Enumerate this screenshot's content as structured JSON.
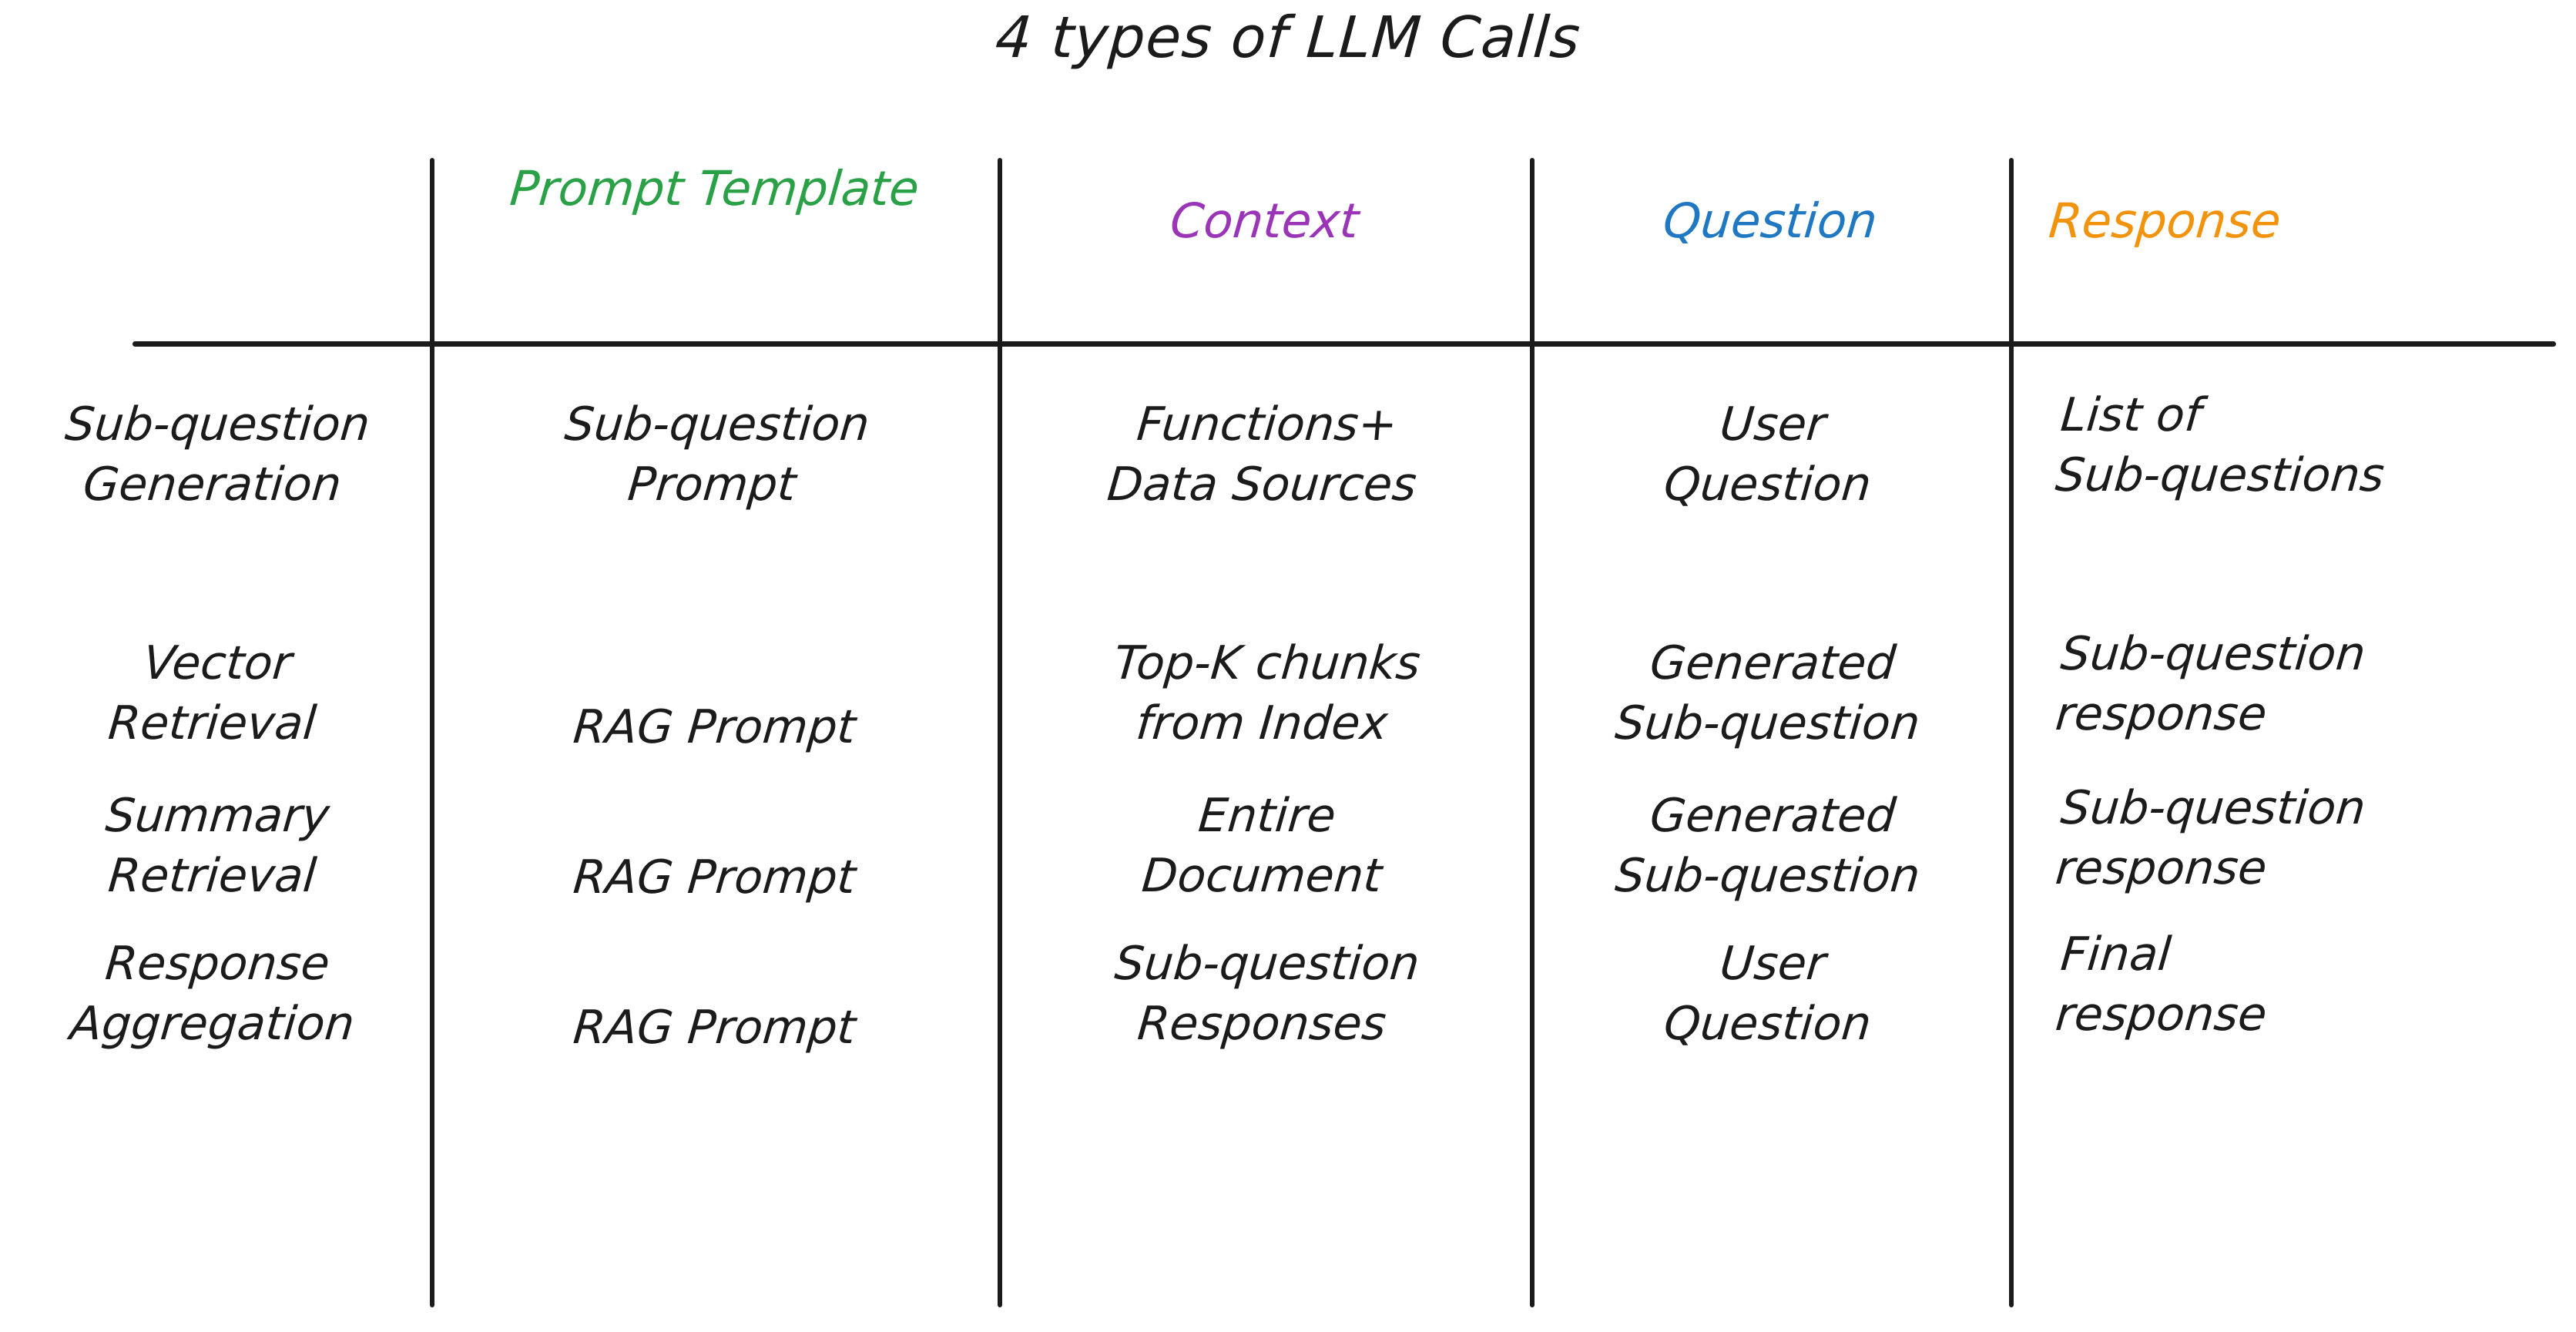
{
  "title": "4 types of LLM Calls",
  "colors": {
    "ink": "#1b1b1b",
    "prompt_template": "#2aa047",
    "context": "#9a35b8",
    "question": "#1f78c1",
    "response": "#f2930d"
  },
  "table": {
    "headers": [
      {
        "label": "",
        "color": "#1b1b1b"
      },
      {
        "label": "Prompt\nTemplate",
        "color": "#2aa047"
      },
      {
        "label": "Context",
        "color": "#9a35b8"
      },
      {
        "label": "Question",
        "color": "#1f78c1"
      },
      {
        "label": "Response",
        "color": "#f2930d"
      }
    ],
    "rows": [
      {
        "call_type": "Sub-question\nGeneration",
        "prompt_template": "Sub-question\nPrompt",
        "context": "Functions+\nData Sources",
        "question": "User\nQuestion",
        "response": "List of\nSub-questions"
      },
      {
        "call_type": "Vector\nRetrieval",
        "prompt_template": "RAG Prompt",
        "context": "Top-K chunks\nfrom Index",
        "question": "Generated\nSub-question",
        "response": "Sub-question\nresponse"
      },
      {
        "call_type": "Summary\nRetrieval",
        "prompt_template": "RAG Prompt",
        "context": "Entire\nDocument",
        "question": "Generated\nSub-question",
        "response": "Sub-question\nresponse"
      },
      {
        "call_type": "Response\nAggregation",
        "prompt_template": "RAG Prompt",
        "context": "Sub-question\nResponses",
        "question": "User\nQuestion",
        "response": "Final\nresponse"
      }
    ]
  },
  "chart_data": {
    "type": "table",
    "title": "4 types of LLM Calls",
    "columns": [
      "",
      "Prompt Template",
      "Context",
      "Question",
      "Response"
    ],
    "rows": [
      [
        "Sub-question Generation",
        "Sub-question Prompt",
        "Functions+ Data Sources",
        "User Question",
        "List of Sub-questions"
      ],
      [
        "Vector Retrieval",
        "RAG Prompt",
        "Top-K chunks from Index",
        "Generated Sub-question",
        "Sub-question response"
      ],
      [
        "Summary Retrieval",
        "RAG Prompt",
        "Entire Document",
        "Generated Sub-question",
        "Sub-question response"
      ],
      [
        "Response Aggregation",
        "RAG Prompt",
        "Sub-question Responses",
        "User Question",
        "Final response"
      ]
    ]
  }
}
